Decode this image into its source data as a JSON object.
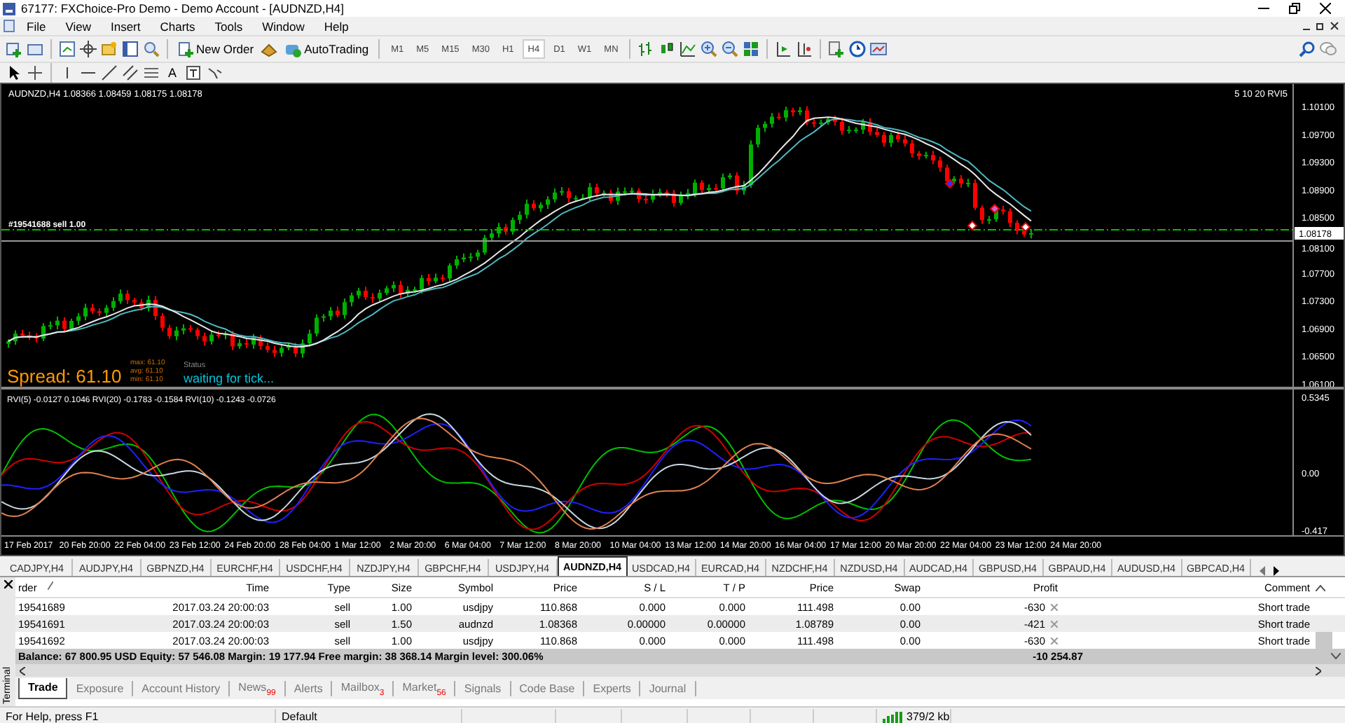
{
  "window": {
    "title": "67177: FXChoice-Pro Demo - Demo Account - [AUDNZD,H4]"
  },
  "menu": [
    "File",
    "View",
    "Insert",
    "Charts",
    "Tools",
    "Window",
    "Help"
  ],
  "toolbar": {
    "new_order": "New Order",
    "auto_trading": "AutoTrading",
    "timeframes": [
      {
        "label": "M1",
        "selected": false
      },
      {
        "label": "M5",
        "selected": false
      },
      {
        "label": "M15",
        "selected": false
      },
      {
        "label": "M30",
        "selected": false
      },
      {
        "label": "H1",
        "selected": false
      },
      {
        "label": "H4",
        "selected": true
      },
      {
        "label": "D1",
        "selected": false
      },
      {
        "label": "W1",
        "selected": false
      },
      {
        "label": "MN",
        "selected": false
      }
    ],
    "text_tool": "A"
  },
  "chart": {
    "header": "AUDNZD,H4  1.08366 1.08459 1.08175 1.08178",
    "indicators": "5 10 20 RVI5",
    "order_line_label": "#19541688 sell 1.00",
    "spread": "Spread: 61.10",
    "spread_stats": [
      "max: 61.10",
      "avg: 61.10",
      "min: 61.10"
    ],
    "status_label": "Status",
    "status_text": "waiting for tick...",
    "price_axis": [
      "1.10100",
      "1.09700",
      "1.09300",
      "1.08900",
      "1.08500",
      "1.08100",
      "1.07700",
      "1.07300",
      "1.06900",
      "1.06500",
      "1.06100"
    ],
    "current_price": "1.08178",
    "indicator_header": "RVI(5) -0.0127 0.1046  RVI(20) -0.1783 -0.1584  RVI(10) -0.1243 -0.0726",
    "indicator_axis": [
      "0.5345",
      "0.00",
      "-0.417"
    ],
    "time_axis": [
      "17 Feb 2017",
      "20 Feb 20:00",
      "22 Feb 04:00",
      "23 Feb 12:00",
      "24 Feb 20:00",
      "28 Feb 04:00",
      "1 Mar 12:00",
      "2 Mar 20:00",
      "6 Mar 04:00",
      "7 Mar 12:00",
      "8 Mar 20:00",
      "10 Mar 04:00",
      "13 Mar 12:00",
      "14 Mar 20:00",
      "16 Mar 04:00",
      "17 Mar 12:00",
      "20 Mar 20:00",
      "22 Mar 04:00",
      "23 Mar 12:00",
      "24 Mar 20:00"
    ]
  },
  "symbol_tabs": [
    {
      "label": "CADJPY,H4",
      "selected": false
    },
    {
      "label": "AUDJPY,H4",
      "selected": false
    },
    {
      "label": "GBPNZD,H4",
      "selected": false
    },
    {
      "label": "EURCHF,H4",
      "selected": false
    },
    {
      "label": "USDCHF,H4",
      "selected": false
    },
    {
      "label": "NZDJPY,H4",
      "selected": false
    },
    {
      "label": "GBPCHF,H4",
      "selected": false
    },
    {
      "label": "USDJPY,H4",
      "selected": false
    },
    {
      "label": "AUDNZD,H4",
      "selected": true
    },
    {
      "label": "USDCAD,H4",
      "selected": false
    },
    {
      "label": "EURCAD,H4",
      "selected": false
    },
    {
      "label": "NZDCHF,H4",
      "selected": false
    },
    {
      "label": "NZDUSD,H4",
      "selected": false
    },
    {
      "label": "AUDCAD,H4",
      "selected": false
    },
    {
      "label": "GBPUSD,H4",
      "selected": false
    },
    {
      "label": "GBPAUD,H4",
      "selected": false
    },
    {
      "label": "AUDUSD,H4",
      "selected": false
    },
    {
      "label": "GBPCAD,H4",
      "selected": false
    }
  ],
  "terminal": {
    "side_label": "Terminal",
    "columns": [
      "rder",
      "Time",
      "Type",
      "Size",
      "Symbol",
      "Price",
      "S / L",
      "T / P",
      "Price",
      "Swap",
      "Profit",
      "Comment"
    ],
    "rows": [
      [
        "19541689",
        "2017.03.24 20:00:03",
        "sell",
        "1.00",
        "usdjpy",
        "110.868",
        "0.000",
        "0.000",
        "111.498",
        "0.00",
        "-630",
        "Short trade"
      ],
      [
        "19541691",
        "2017.03.24 20:00:03",
        "sell",
        "1.50",
        "audnzd",
        "1.08368",
        "0.00000",
        "0.00000",
        "1.08789",
        "0.00",
        "-421",
        "Short trade"
      ],
      [
        "19541692",
        "2017.03.24 20:00:03",
        "sell",
        "1.00",
        "usdjpy",
        "110.868",
        "0.000",
        "0.000",
        "111.498",
        "0.00",
        "-630",
        "Short trade"
      ]
    ],
    "summary": "Balance: 67 800.95 USD  Equity: 57 546.08  Margin: 19 177.94  Free margin: 38 368.14  Margin level: 300.06%",
    "total_profit": "-10 254.87",
    "tabs": [
      {
        "label": "Trade",
        "selected": true
      },
      {
        "label": "Exposure",
        "selected": false
      },
      {
        "label": "Account History",
        "selected": false
      },
      {
        "label": "News",
        "badge": "99",
        "selected": false
      },
      {
        "label": "Alerts",
        "selected": false
      },
      {
        "label": "Mailbox",
        "badge": "3",
        "selected": false
      },
      {
        "label": "Market",
        "badge": "56",
        "selected": false
      },
      {
        "label": "Signals",
        "selected": false
      },
      {
        "label": "Code Base",
        "selected": false
      },
      {
        "label": "Experts",
        "selected": false
      },
      {
        "label": "Journal",
        "selected": false
      }
    ]
  },
  "status_bar": {
    "help": "For Help, press F1",
    "profile": "Default",
    "traffic": "379/2 kb"
  }
}
